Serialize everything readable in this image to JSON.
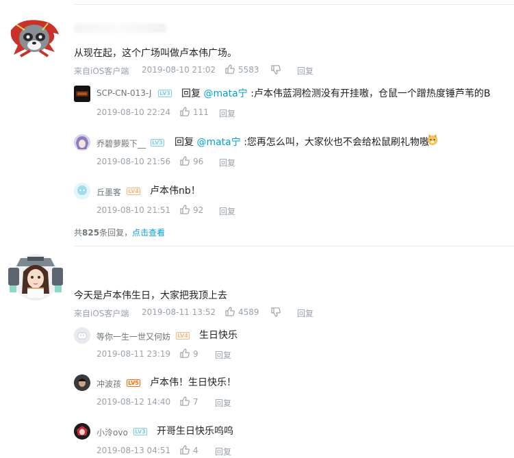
{
  "comments": [
    {
      "text": "从现在起，这个广场叫做卢本伟广场。",
      "client": "来自iOS客户端",
      "time": "2019-08-10 21:02",
      "likes": "5583",
      "reply": "回复",
      "sub_replies": [
        {
          "user": "SCP-CN-013-J",
          "level": "LV3",
          "reply_prefix": "回复",
          "at": "@mata宁",
          "text": " :卢本伟蓝洞检测没有开挂嗷，仓鼠一个蹭热度锤芦苇的B",
          "time": "2019-08-10 22:24",
          "likes": "111",
          "reply": "回复"
        },
        {
          "user": "乔碧萝殿下__",
          "level": "LV3",
          "reply_prefix": "回复",
          "at": "@mata宁",
          "text": " :您再怎么叫，大家伙也不会给松鼠刷礼物嗷",
          "time": "2019-08-10 21:56",
          "likes": "96",
          "reply": "回复"
        },
        {
          "user": "丘墨客",
          "level": "LV4",
          "text": "卢本伟nb！",
          "time": "2019-08-10 21:51",
          "likes": "92",
          "reply": "回复"
        }
      ],
      "more_prefix": "共",
      "more_count": "825",
      "more_suffix": "条回复，",
      "more_link": "点击查看"
    },
    {
      "text": "今天是卢本伟生日，大家把我顶上去",
      "client": "来自iOS客户端",
      "time": "2019-08-11 13:52",
      "likes": "4589",
      "reply": "回复",
      "sub_replies": [
        {
          "user": "等你一生一世又何妨",
          "level": "LV4",
          "text": "生日快乐",
          "time": "2019-08-11 23:19",
          "likes": "9",
          "reply": "回复"
        },
        {
          "user": "冲波孩",
          "level": "LV5",
          "text": "卢本伟！生日快乐！",
          "time": "2019-08-12 14:40",
          "likes": "7",
          "reply": "回复"
        },
        {
          "user": "小泠ovo",
          "level": "LV3",
          "text": "开哥生日快乐呜呜",
          "time": "2019-08-13 04:51",
          "likes": "4",
          "reply": "回复"
        }
      ]
    }
  ],
  "colors": {
    "link": "#00a1d6",
    "meta": "#99a2aa",
    "lv5": "#ff6c00",
    "lv3": "#7bcdef",
    "lv4": "#ffb37c"
  }
}
